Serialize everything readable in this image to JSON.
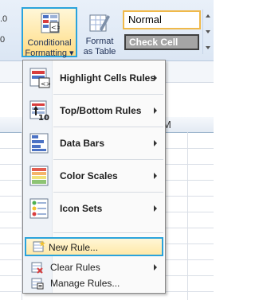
{
  "ribbon": {
    "left_partial_1": ".0",
    "left_partial_2": "0",
    "conditional_formatting_line1": "Conditional",
    "conditional_formatting_line2": "Formatting ▾",
    "format_as_table_line1": "Format",
    "format_as_table_line2": "as Table ▾",
    "style_normal": "Normal",
    "style_check_cell": "Check Cell"
  },
  "sheet": {
    "visible_column_letter": "M"
  },
  "menu": {
    "items": [
      {
        "label": "Highlight Cells Rules",
        "icon": "highlight-cells-rules-icon",
        "submenu": true
      },
      {
        "label": "Top/Bottom Rules",
        "icon": "top-bottom-rules-icon",
        "submenu": true
      },
      {
        "label": "Data Bars",
        "icon": "data-bars-icon",
        "submenu": true
      },
      {
        "label": "Color Scales",
        "icon": "color-scales-icon",
        "submenu": true
      },
      {
        "label": "Icon Sets",
        "icon": "icon-sets-icon",
        "submenu": true
      },
      {
        "label": "New Rule...",
        "icon": "new-rule-icon",
        "submenu": false,
        "highlighted": true
      },
      {
        "label": "Clear Rules",
        "icon": "clear-rules-icon",
        "submenu": true
      },
      {
        "label": "Manage Rules...",
        "icon": "manage-rules-icon",
        "submenu": false
      }
    ]
  },
  "colors": {
    "highlight_border": "#2aa3dc",
    "style_normal_border": "#f0b94a",
    "check_cell_fill": "#a5a5a5"
  }
}
